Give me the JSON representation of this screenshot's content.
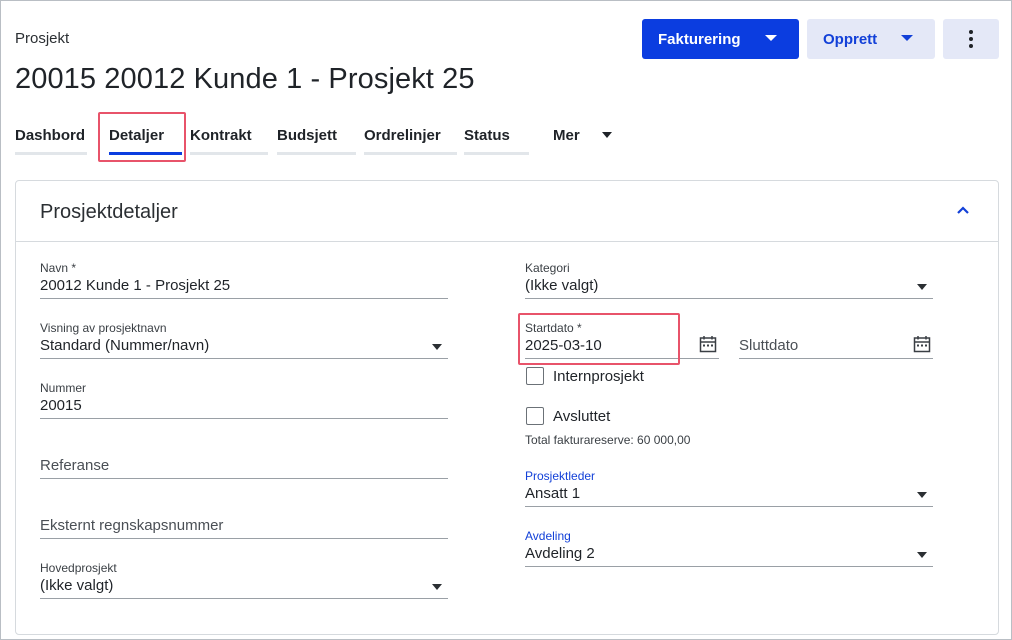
{
  "breadcrumb": "Prosjekt",
  "title": "20015 20012 Kunde 1 - Prosjekt 25",
  "actions": {
    "invoice_label": "Fakturering",
    "create_label": "Opprett"
  },
  "tabs": [
    {
      "label": "Dashbord"
    },
    {
      "label": "Detaljer"
    },
    {
      "label": "Kontrakt"
    },
    {
      "label": "Budsjett"
    },
    {
      "label": "Ordrelinjer"
    },
    {
      "label": "Status"
    },
    {
      "label": "Mer"
    }
  ],
  "section": {
    "title": "Prosjektdetaljer"
  },
  "fields": {
    "navn": {
      "label": "Navn *",
      "value": "20012 Kunde 1 - Prosjekt 25"
    },
    "visning": {
      "label": "Visning av prosjektnavn",
      "value": "Standard (Nummer/navn)"
    },
    "nummer": {
      "label": "Nummer",
      "value": "20015"
    },
    "referanse": {
      "placeholder": "Referanse"
    },
    "eksternt": {
      "placeholder": "Eksternt regnskapsnummer"
    },
    "hovedprosjekt": {
      "label": "Hovedprosjekt",
      "value": "(Ikke valgt)"
    },
    "kategori": {
      "label": "Kategori",
      "value": "(Ikke valgt)"
    },
    "startdato": {
      "label": "Startdato *",
      "value": "2025-03-10"
    },
    "sluttdato": {
      "placeholder": "Sluttdato"
    },
    "internprosjekt": {
      "label": "Internprosjekt",
      "checked": false
    },
    "avsluttet": {
      "label": "Avsluttet",
      "checked": false
    },
    "fakturareserve": "Total fakturareserve: 60 000,00",
    "prosjektleder": {
      "label": "Prosjektleder",
      "value": "Ansatt 1"
    },
    "avdeling": {
      "label": "Avdeling",
      "value": "Avdeling 2"
    }
  },
  "colors": {
    "primary": "#0b3de0",
    "secondary_bg": "#e4e8f7",
    "highlight": "#e8536a"
  },
  "icons": [
    "chevron-down-icon",
    "more-vertical-icon",
    "chevron-up-icon",
    "calendar-icon"
  ]
}
